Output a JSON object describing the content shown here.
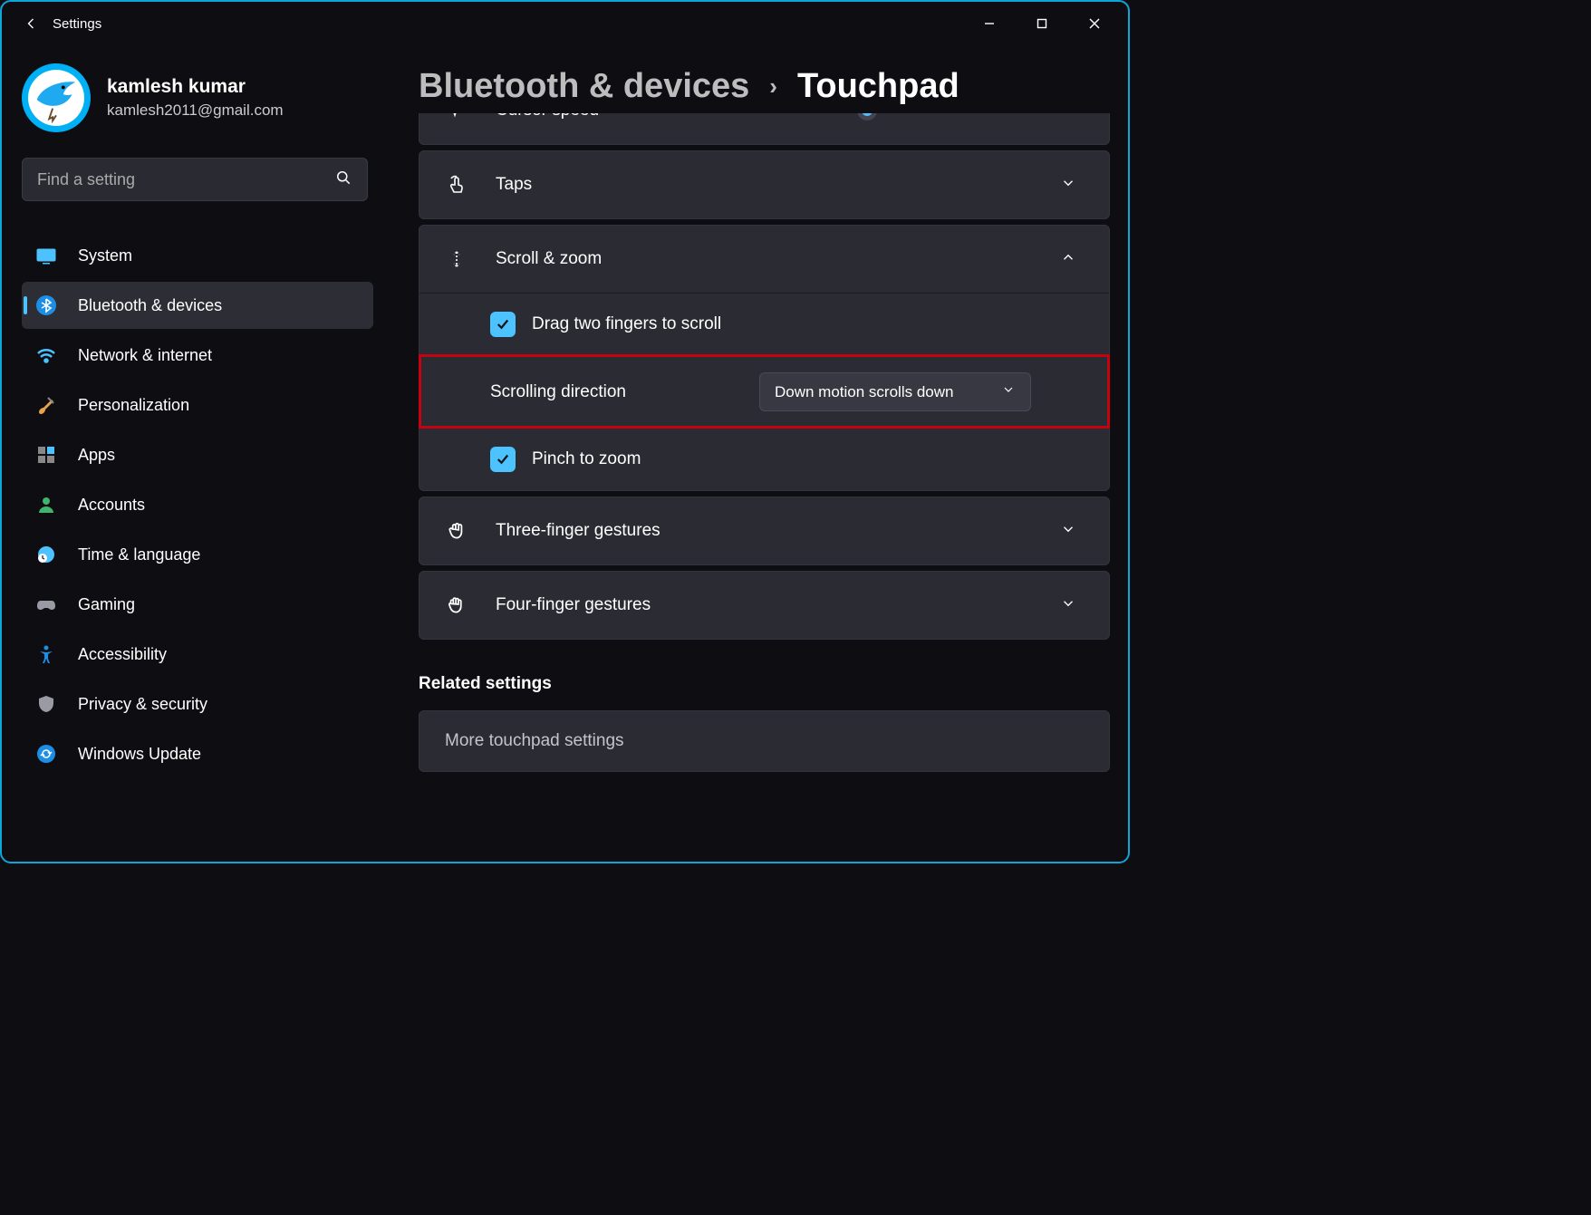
{
  "titlebar": {
    "title": "Settings"
  },
  "profile": {
    "name": "kamlesh kumar",
    "email": "kamlesh2011@gmail.com"
  },
  "search": {
    "placeholder": "Find a setting"
  },
  "nav": {
    "items": [
      {
        "label": "System"
      },
      {
        "label": "Bluetooth & devices"
      },
      {
        "label": "Network & internet"
      },
      {
        "label": "Personalization"
      },
      {
        "label": "Apps"
      },
      {
        "label": "Accounts"
      },
      {
        "label": "Time & language"
      },
      {
        "label": "Gaming"
      },
      {
        "label": "Accessibility"
      },
      {
        "label": "Privacy & security"
      },
      {
        "label": "Windows Update"
      }
    ]
  },
  "breadcrumb": {
    "parent": "Bluetooth & devices",
    "current": "Touchpad"
  },
  "panels": {
    "cursor_speed": "Cursor speed",
    "taps": "Taps",
    "scroll_zoom": "Scroll & zoom",
    "drag_two": "Drag two fingers to scroll",
    "scroll_dir_label": "Scrolling direction",
    "scroll_dir_value": "Down motion scrolls down",
    "pinch": "Pinch to zoom",
    "three_finger": "Three-finger gestures",
    "four_finger": "Four-finger gestures"
  },
  "related": {
    "heading": "Related settings",
    "more": "More touchpad settings"
  }
}
